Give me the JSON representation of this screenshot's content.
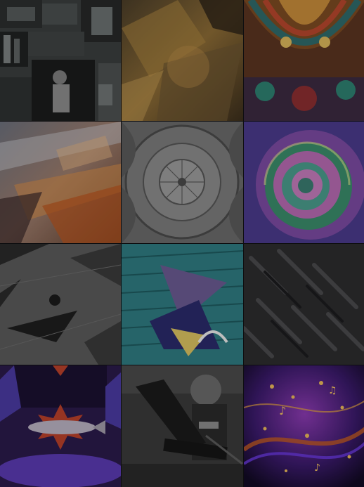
{
  "gallery": {
    "tiles": [
      {
        "art": "collage-figure-art",
        "tone": "grayscale"
      },
      {
        "art": "golden-abstract-art",
        "tone": "gold"
      },
      {
        "art": "ornate-ceiling-art",
        "tone": "multicolor"
      },
      {
        "art": "motion-blur-art",
        "tone": "warm"
      },
      {
        "art": "dome-ceiling-art",
        "tone": "grayscale"
      },
      {
        "art": "psychedelic-spiral-art",
        "tone": "purple-green"
      },
      {
        "art": "geometric-floor-art",
        "tone": "grayscale"
      },
      {
        "art": "brick-graffiti-art",
        "tone": "teal"
      },
      {
        "art": "dark-streaks-art",
        "tone": "dark-gray"
      },
      {
        "art": "fish-star-art",
        "tone": "purple-red"
      },
      {
        "art": "guitarist-art",
        "tone": "grayscale"
      },
      {
        "art": "music-notes-lights-art",
        "tone": "purple-orange"
      }
    ]
  }
}
